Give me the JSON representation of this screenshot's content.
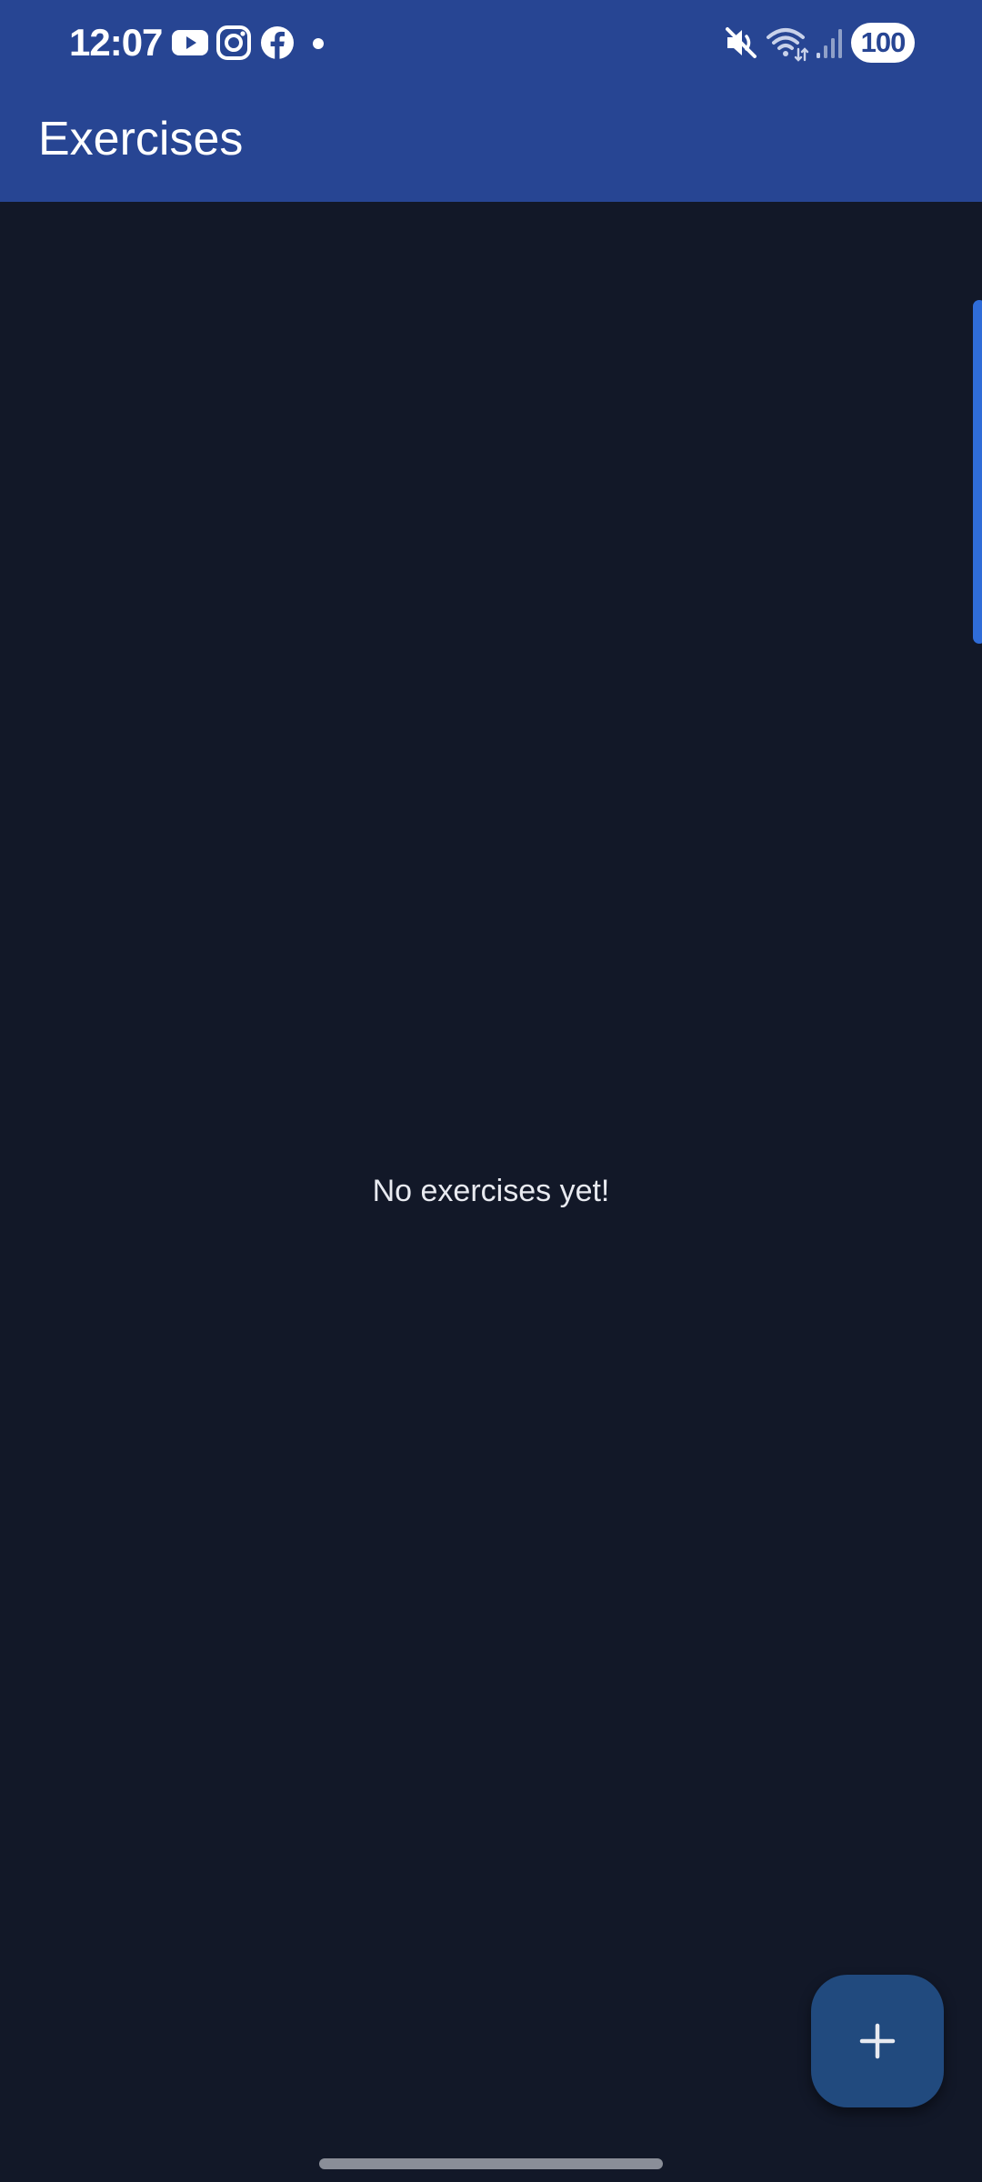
{
  "status_bar": {
    "time": "12:07",
    "notification_icons": [
      "youtube-icon",
      "instagram-icon",
      "facebook-icon",
      "more-notifications-dot"
    ],
    "system_icons": [
      "mute-icon",
      "wifi-icon",
      "signal-icon"
    ],
    "battery": "100"
  },
  "app_bar": {
    "title": "Exercises"
  },
  "main": {
    "empty_message": "No exercises yet!"
  },
  "fab": {
    "icon": "plus-icon"
  },
  "colors": {
    "app_bar": "#274593",
    "background": "#121828",
    "fab": "#214a7e",
    "scroll_indicator": "#2f6cd8"
  }
}
